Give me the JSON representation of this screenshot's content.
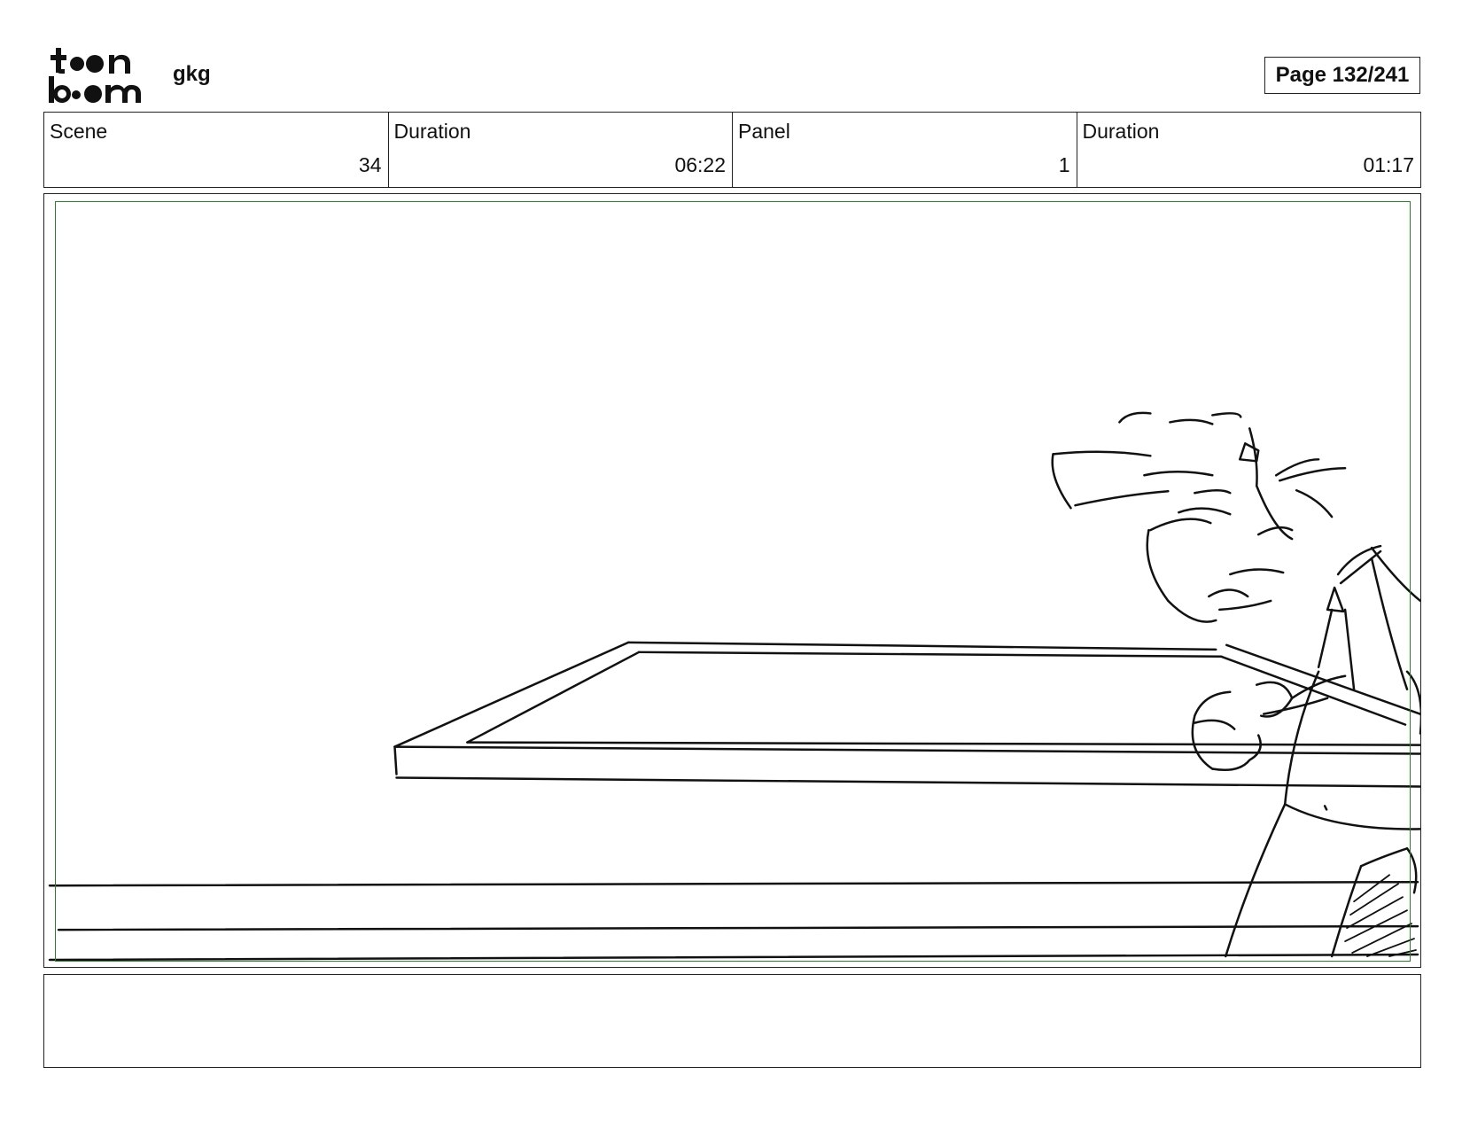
{
  "header": {
    "logo_text": "toonboom",
    "project_name": "gkg",
    "page_label": "Page 132/241"
  },
  "info": {
    "scene_label": "Scene",
    "scene_value": "34",
    "scene_duration_label": "Duration",
    "scene_duration_value": "06:22",
    "panel_label": "Panel",
    "panel_value": "1",
    "panel_duration_label": "Duration",
    "panel_duration_value": "01:17"
  },
  "colors": {
    "safe_frame": "#2e7d2e",
    "border": "#222222"
  },
  "notes": {
    "text": ""
  }
}
